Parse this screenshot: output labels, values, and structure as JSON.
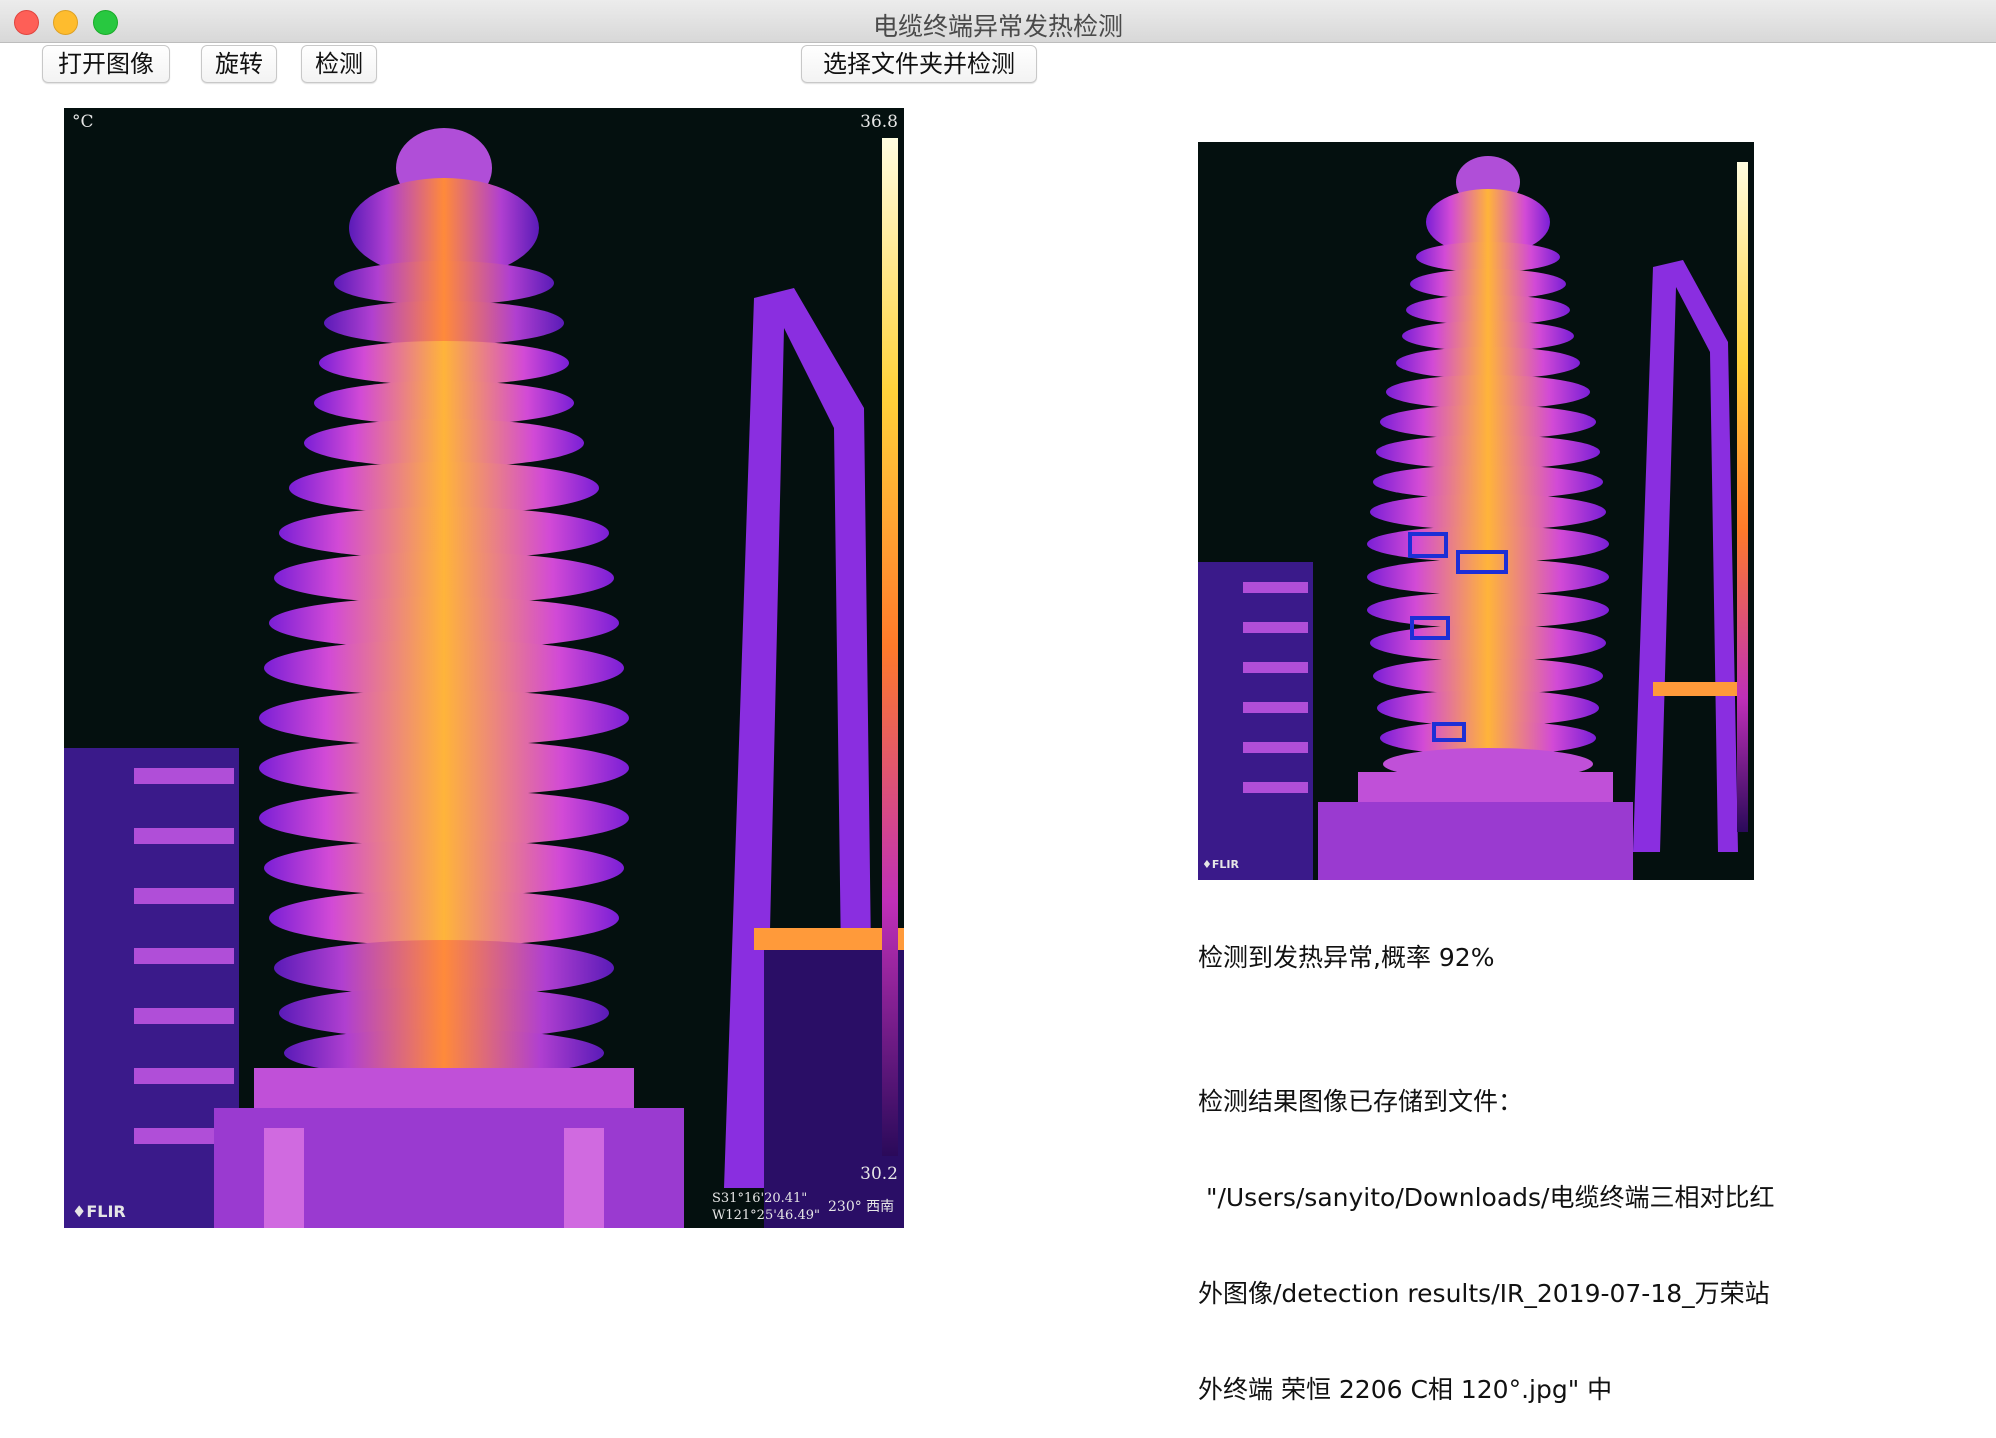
{
  "window": {
    "title": "电缆终端异常发热检测"
  },
  "toolbar": {
    "open_label": "打开图像",
    "rotate_label": "旋转",
    "detect_label": "检测",
    "folder_detect_label": "选择文件夹并检测"
  },
  "source_image": {
    "unit": "°C",
    "scale_max": "36.8",
    "scale_min": "30.2",
    "brand": "FLIR",
    "gps_lat": "S31°16'20.41\"",
    "gps_lon": "W121°25'46.49\"",
    "heading": "230° 西南"
  },
  "result_image": {
    "brand": "FLIR",
    "detections_count": 4
  },
  "result": {
    "status": "检测到发热异常,概率 92%",
    "saved_heading": "检测结果图像已存储到文件：",
    "saved_path_line1": " \"/Users/sanyito/Downloads/电缆终端三相对比红",
    "saved_path_line2": "外图像/detection results/IR_2019-07-18_万荣站",
    "saved_path_line3": "外终端 荣恒 2206 C相 120°.jpg\" 中"
  },
  "colors": {
    "thermal_bg": "#04100f",
    "detection_box": "#1d2fd6",
    "scale_top": "#fffde0",
    "scale_bottom": "#2a0a5a"
  }
}
